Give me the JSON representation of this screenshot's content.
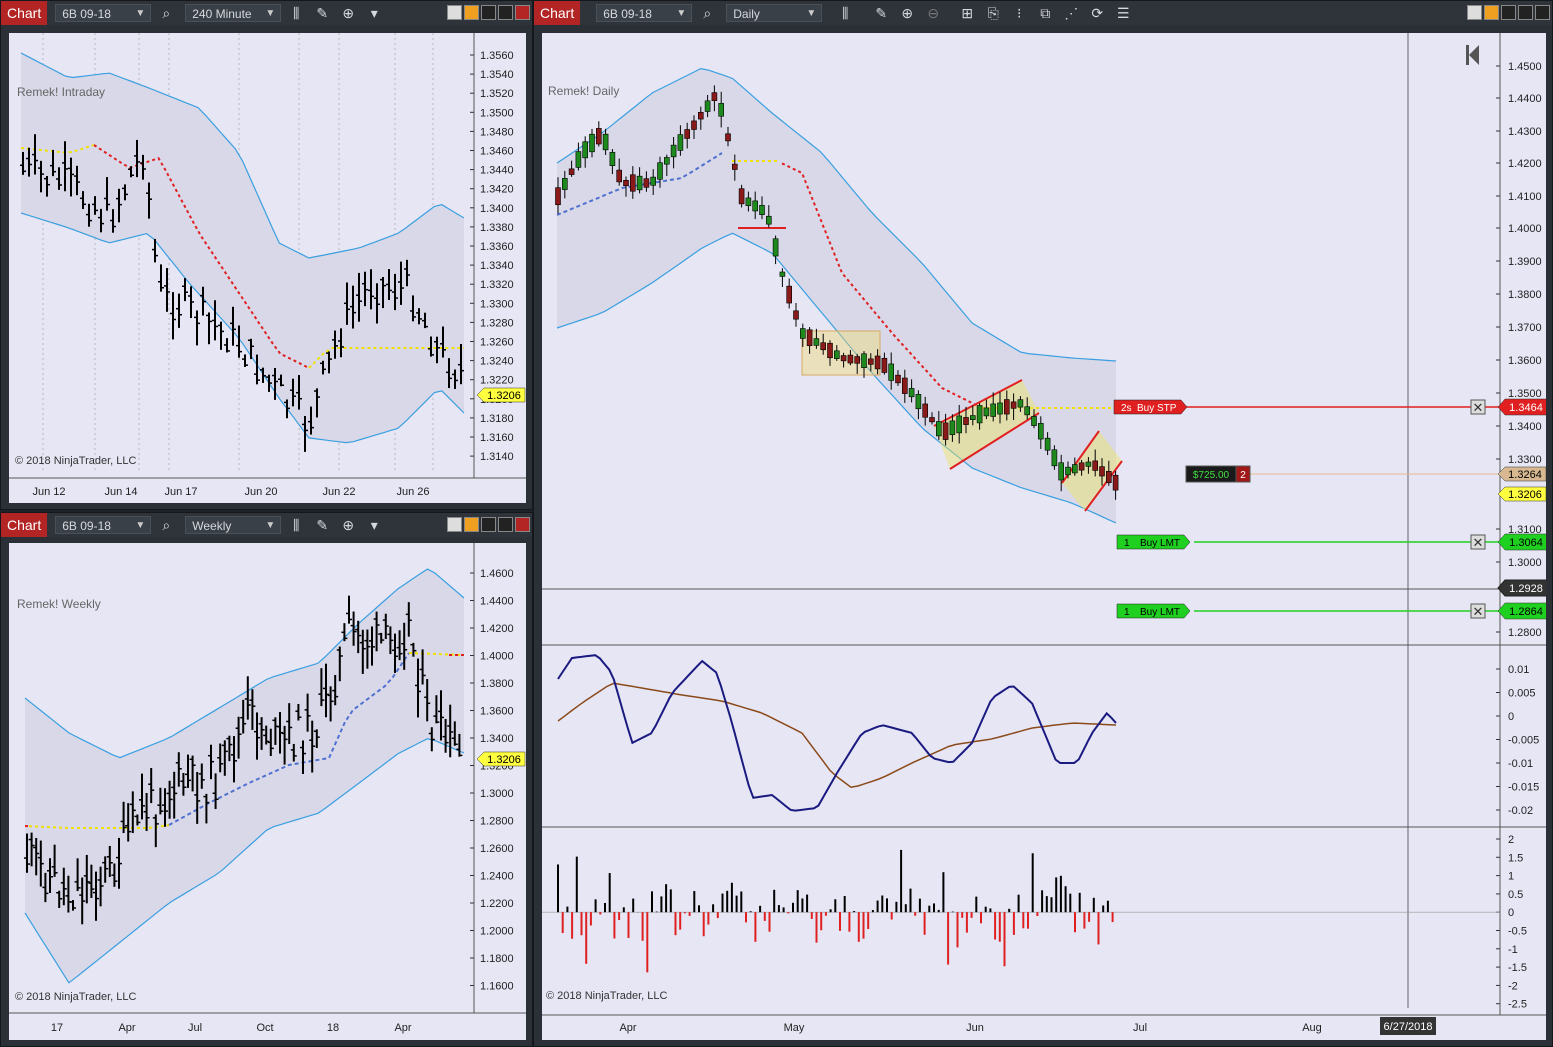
{
  "windows": [
    {
      "id": "tl",
      "title": "Chart",
      "instrument": "6B 09-18",
      "period": "240 Minute",
      "chart_label": "Remek! Intraday",
      "copyright": "© 2018 NinjaTrader, LLC",
      "price_ticks": [
        "1.3560",
        "1.3540",
        "1.3520",
        "1.3500",
        "1.3480",
        "1.3460",
        "1.3440",
        "1.3420",
        "1.3400",
        "1.3380",
        "1.3360",
        "1.3340",
        "1.3320",
        "1.3300",
        "1.3280",
        "1.3260",
        "1.3240",
        "1.3220",
        "1.3200",
        "1.3180",
        "1.3160",
        "1.3140"
      ],
      "time_ticks": [
        "Jun 12",
        "Jun 14",
        "Jun 17",
        "Jun 20",
        "Jun 22",
        "Jun 26"
      ],
      "last_price": "1.3206"
    },
    {
      "id": "bl",
      "title": "Chart",
      "instrument": "6B 09-18",
      "period": "Weekly",
      "chart_label": "Remek! Weekly",
      "copyright": "© 2018 NinjaTrader, LLC",
      "price_ticks": [
        "1.4600",
        "1.4400",
        "1.4200",
        "1.4000",
        "1.3800",
        "1.3600",
        "1.3400",
        "1.3200",
        "1.3000",
        "1.2800",
        "1.2600",
        "1.2400",
        "1.2200",
        "1.2000",
        "1.1800",
        "1.1600"
      ],
      "time_ticks": [
        "17",
        "Apr",
        "Jul",
        "Oct",
        "18",
        "Apr"
      ],
      "last_price": "1.3206"
    },
    {
      "id": "main",
      "title": "Chart",
      "instrument": "6B 09-18",
      "period": "Daily",
      "chart_label": "Remek! Daily",
      "copyright": "© 2018 NinjaTrader, LLC",
      "price_ticks": [
        "1.4500",
        "1.4400",
        "1.4300",
        "1.4200",
        "1.4100",
        "1.4000",
        "1.3900",
        "1.3800",
        "1.3700",
        "1.3600",
        "1.3500",
        "1.3400",
        "1.3300",
        "1.3100",
        "1.3000",
        "1.2800"
      ],
      "osc_ticks": [
        "0.01",
        "0.005",
        "0",
        "-0.005",
        "-0.01",
        "-0.015",
        "-0.02"
      ],
      "hist_ticks": [
        "2",
        "1.5",
        "1",
        "0.5",
        "0",
        "-0.5",
        "-1",
        "-1.5",
        "-2",
        "-2.5"
      ],
      "time_ticks": [
        "Apr",
        "May",
        "Jun",
        "Jul",
        "Aug"
      ],
      "cursor_date": "6/27/2018",
      "orders": [
        {
          "qty": "2s",
          "type": "Buy STP",
          "price": "1.3464",
          "color": "#e02020"
        },
        {
          "qty": "1",
          "type": "Buy LMT",
          "price": "1.3064",
          "color": "#20d020"
        },
        {
          "qty": "1",
          "type": "Buy LMT",
          "price": "1.2864",
          "color": "#20d020"
        }
      ],
      "position": {
        "pnl": "$725.00",
        "qty": "2",
        "avg_price": "1.3264"
      },
      "last_price": "1.3206",
      "crosshair_price": "1.2928"
    }
  ],
  "colors": {
    "accent": "#b32424",
    "background": "#e6e6f5",
    "band": "#d6d6e6"
  }
}
